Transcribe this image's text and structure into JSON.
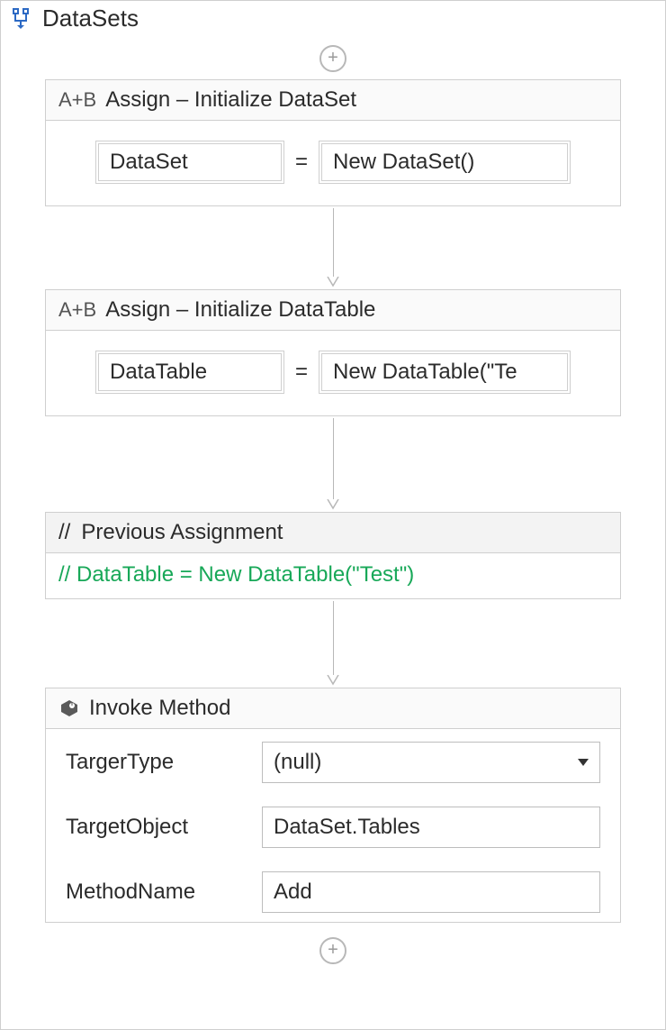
{
  "sequence": {
    "title": "DataSets"
  },
  "activities": {
    "assign1": {
      "prefix": "A+B",
      "title": "Assign – Initialize DataSet",
      "lhs": "DataSet",
      "eq": "=",
      "rhs": "New DataSet()"
    },
    "assign2": {
      "prefix": "A+B",
      "title": "Assign – Initialize DataTable",
      "lhs": "DataTable",
      "eq": "=",
      "rhs": "New DataTable(\"Te"
    },
    "comment": {
      "prefix": "//",
      "title": "Previous Assignment",
      "body": "// DataTable = New DataTable(\"Test\")"
    },
    "invoke": {
      "title": "Invoke Method",
      "fields": {
        "targetType": {
          "label": "TargerType",
          "value": "(null)"
        },
        "targetObject": {
          "label": "TargetObject",
          "value": "DataSet.Tables"
        },
        "methodName": {
          "label": "MethodName",
          "value": "Add"
        }
      }
    }
  }
}
